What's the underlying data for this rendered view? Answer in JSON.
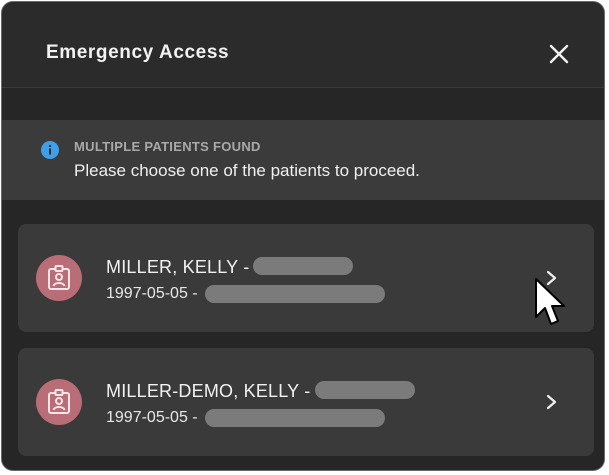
{
  "dialog": {
    "title": "Emergency Access",
    "close_icon": "close-icon"
  },
  "info": {
    "icon": "info-icon",
    "heading": "MULTIPLE PATIENTS FOUND",
    "message": "Please choose one of the patients to proceed."
  },
  "patients": [
    {
      "name": "MILLER, KELLY -",
      "dob": "1997-05-05 -",
      "icon": "patient-badge-icon"
    },
    {
      "name": "MILLER-DEMO, KELLY -",
      "dob": "1997-05-05 -",
      "icon": "patient-badge-icon"
    }
  ],
  "colors": {
    "dialog_bg": "#2a2a2a",
    "card_bg": "#3a3a3a",
    "avatar_bg": "#b96d76",
    "info_icon": "#3da0e8"
  }
}
